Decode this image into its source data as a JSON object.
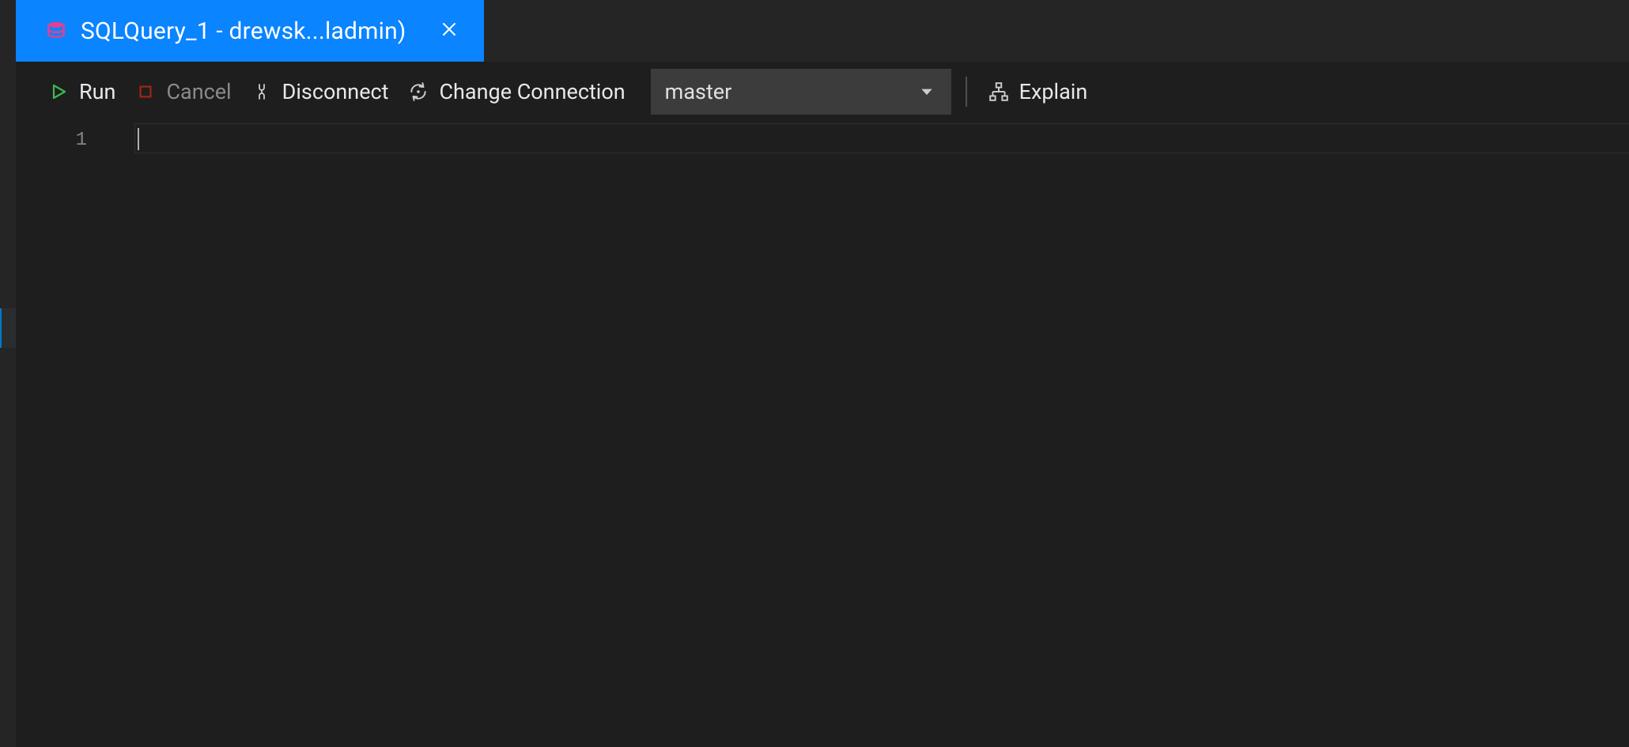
{
  "tab": {
    "title": "SQLQuery_1 - drewsk...ladmin)"
  },
  "toolbar": {
    "run_label": "Run",
    "cancel_label": "Cancel",
    "disconnect_label": "Disconnect",
    "change_connection_label": "Change Connection",
    "explain_label": "Explain"
  },
  "database_selector": {
    "selected": "master"
  },
  "editor": {
    "line_number": "1"
  },
  "colors": {
    "tab_active_bg": "#0a84ff",
    "icon_db": "#e83e8c",
    "icon_run": "#3fb950",
    "icon_cancel": "#a1260d"
  }
}
